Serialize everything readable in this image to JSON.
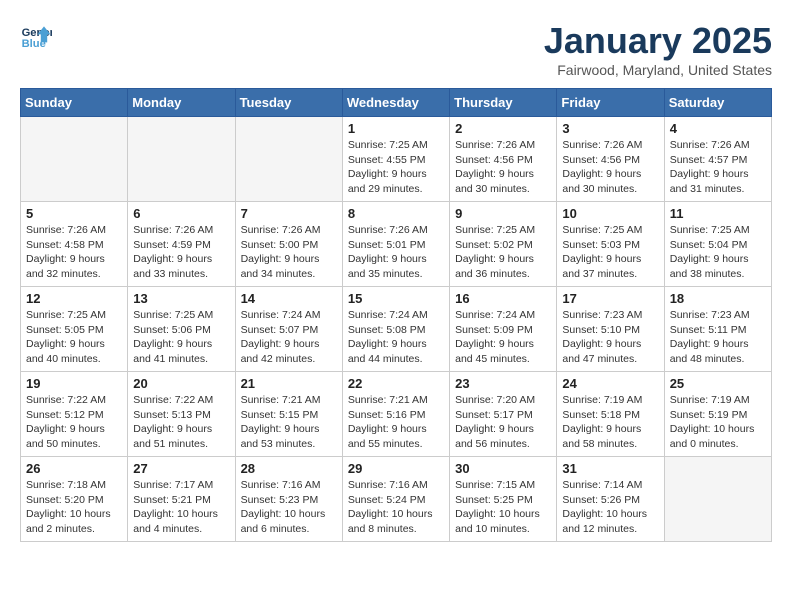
{
  "header": {
    "logo_line1": "General",
    "logo_line2": "Blue",
    "month": "January 2025",
    "location": "Fairwood, Maryland, United States"
  },
  "weekdays": [
    "Sunday",
    "Monday",
    "Tuesday",
    "Wednesday",
    "Thursday",
    "Friday",
    "Saturday"
  ],
  "weeks": [
    [
      {
        "day": "",
        "info": ""
      },
      {
        "day": "",
        "info": ""
      },
      {
        "day": "",
        "info": ""
      },
      {
        "day": "1",
        "info": "Sunrise: 7:25 AM\nSunset: 4:55 PM\nDaylight: 9 hours\nand 29 minutes."
      },
      {
        "day": "2",
        "info": "Sunrise: 7:26 AM\nSunset: 4:56 PM\nDaylight: 9 hours\nand 30 minutes."
      },
      {
        "day": "3",
        "info": "Sunrise: 7:26 AM\nSunset: 4:56 PM\nDaylight: 9 hours\nand 30 minutes."
      },
      {
        "day": "4",
        "info": "Sunrise: 7:26 AM\nSunset: 4:57 PM\nDaylight: 9 hours\nand 31 minutes."
      }
    ],
    [
      {
        "day": "5",
        "info": "Sunrise: 7:26 AM\nSunset: 4:58 PM\nDaylight: 9 hours\nand 32 minutes."
      },
      {
        "day": "6",
        "info": "Sunrise: 7:26 AM\nSunset: 4:59 PM\nDaylight: 9 hours\nand 33 minutes."
      },
      {
        "day": "7",
        "info": "Sunrise: 7:26 AM\nSunset: 5:00 PM\nDaylight: 9 hours\nand 34 minutes."
      },
      {
        "day": "8",
        "info": "Sunrise: 7:26 AM\nSunset: 5:01 PM\nDaylight: 9 hours\nand 35 minutes."
      },
      {
        "day": "9",
        "info": "Sunrise: 7:25 AM\nSunset: 5:02 PM\nDaylight: 9 hours\nand 36 minutes."
      },
      {
        "day": "10",
        "info": "Sunrise: 7:25 AM\nSunset: 5:03 PM\nDaylight: 9 hours\nand 37 minutes."
      },
      {
        "day": "11",
        "info": "Sunrise: 7:25 AM\nSunset: 5:04 PM\nDaylight: 9 hours\nand 38 minutes."
      }
    ],
    [
      {
        "day": "12",
        "info": "Sunrise: 7:25 AM\nSunset: 5:05 PM\nDaylight: 9 hours\nand 40 minutes."
      },
      {
        "day": "13",
        "info": "Sunrise: 7:25 AM\nSunset: 5:06 PM\nDaylight: 9 hours\nand 41 minutes."
      },
      {
        "day": "14",
        "info": "Sunrise: 7:24 AM\nSunset: 5:07 PM\nDaylight: 9 hours\nand 42 minutes."
      },
      {
        "day": "15",
        "info": "Sunrise: 7:24 AM\nSunset: 5:08 PM\nDaylight: 9 hours\nand 44 minutes."
      },
      {
        "day": "16",
        "info": "Sunrise: 7:24 AM\nSunset: 5:09 PM\nDaylight: 9 hours\nand 45 minutes."
      },
      {
        "day": "17",
        "info": "Sunrise: 7:23 AM\nSunset: 5:10 PM\nDaylight: 9 hours\nand 47 minutes."
      },
      {
        "day": "18",
        "info": "Sunrise: 7:23 AM\nSunset: 5:11 PM\nDaylight: 9 hours\nand 48 minutes."
      }
    ],
    [
      {
        "day": "19",
        "info": "Sunrise: 7:22 AM\nSunset: 5:12 PM\nDaylight: 9 hours\nand 50 minutes."
      },
      {
        "day": "20",
        "info": "Sunrise: 7:22 AM\nSunset: 5:13 PM\nDaylight: 9 hours\nand 51 minutes."
      },
      {
        "day": "21",
        "info": "Sunrise: 7:21 AM\nSunset: 5:15 PM\nDaylight: 9 hours\nand 53 minutes."
      },
      {
        "day": "22",
        "info": "Sunrise: 7:21 AM\nSunset: 5:16 PM\nDaylight: 9 hours\nand 55 minutes."
      },
      {
        "day": "23",
        "info": "Sunrise: 7:20 AM\nSunset: 5:17 PM\nDaylight: 9 hours\nand 56 minutes."
      },
      {
        "day": "24",
        "info": "Sunrise: 7:19 AM\nSunset: 5:18 PM\nDaylight: 9 hours\nand 58 minutes."
      },
      {
        "day": "25",
        "info": "Sunrise: 7:19 AM\nSunset: 5:19 PM\nDaylight: 10 hours\nand 0 minutes."
      }
    ],
    [
      {
        "day": "26",
        "info": "Sunrise: 7:18 AM\nSunset: 5:20 PM\nDaylight: 10 hours\nand 2 minutes."
      },
      {
        "day": "27",
        "info": "Sunrise: 7:17 AM\nSunset: 5:21 PM\nDaylight: 10 hours\nand 4 minutes."
      },
      {
        "day": "28",
        "info": "Sunrise: 7:16 AM\nSunset: 5:23 PM\nDaylight: 10 hours\nand 6 minutes."
      },
      {
        "day": "29",
        "info": "Sunrise: 7:16 AM\nSunset: 5:24 PM\nDaylight: 10 hours\nand 8 minutes."
      },
      {
        "day": "30",
        "info": "Sunrise: 7:15 AM\nSunset: 5:25 PM\nDaylight: 10 hours\nand 10 minutes."
      },
      {
        "day": "31",
        "info": "Sunrise: 7:14 AM\nSunset: 5:26 PM\nDaylight: 10 hours\nand 12 minutes."
      },
      {
        "day": "",
        "info": ""
      }
    ]
  ]
}
